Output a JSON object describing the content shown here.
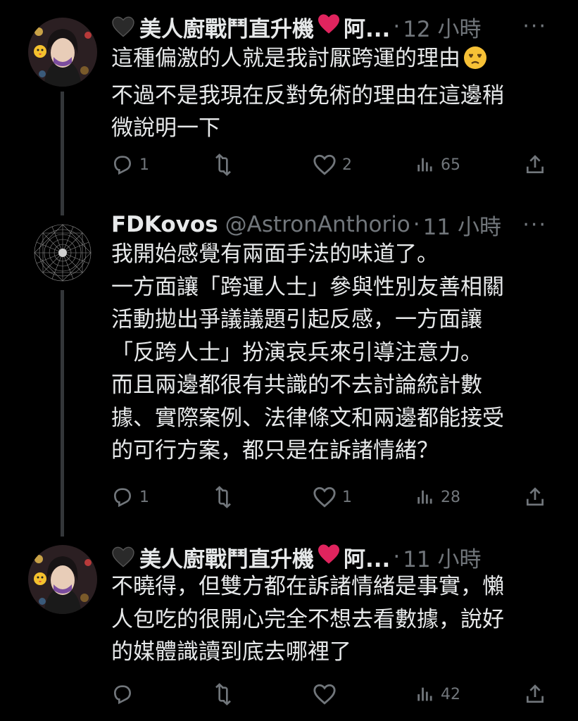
{
  "tweets": [
    {
      "name": "美人廚戰鬥直升機",
      "name_suffix": "阿...",
      "time": "12 小時",
      "lines": [
        "這種偏激的人就是我討厭跨運的理由",
        "不過不是我現在反對免術的理由在這邊稍",
        "微說明一下"
      ],
      "line1_emoji": "unamused-face-emoji",
      "replies": "1",
      "retweets": "",
      "likes": "2",
      "views": "65",
      "avatar": "woman-avatar-icon"
    },
    {
      "name": "FDKovos",
      "handle": "@AstronAnthorio",
      "time": "11 小時",
      "lines": [
        "我開始感覺有兩面手法的味道了。",
        "一方面讓「跨運人士」參與性別友善相關",
        "活動拋出爭議議題引起反感，一方面讓",
        "「反跨人士」扮演哀兵來引導注意力。",
        "而且兩邊都很有共識的不去討論統計數",
        "據、實際案例、法律條文和兩邊都能接受",
        "的可行方案，都只是在訴諸情緒？"
      ],
      "replies": "1",
      "retweets": "",
      "likes": "1",
      "views": "28",
      "avatar": "geometric-pattern-avatar-icon"
    },
    {
      "name": "美人廚戰鬥直升機",
      "name_suffix": "阿...",
      "time": "11 小時",
      "lines": [
        "不曉得，但雙方都在訴諸情緒是事實，懶",
        "人包吃的很開心完全不想去看數據，說好",
        "的媒體識讀到底去哪裡了"
      ],
      "replies": "",
      "retweets": "",
      "likes": "",
      "views": "42",
      "avatar": "woman-avatar-icon"
    }
  ],
  "ui": {
    "separator": "·",
    "more": "···"
  },
  "colors": {
    "background": "#000000",
    "text": "#e7e9ea",
    "muted": "#71767b",
    "heart": "#f91880"
  }
}
